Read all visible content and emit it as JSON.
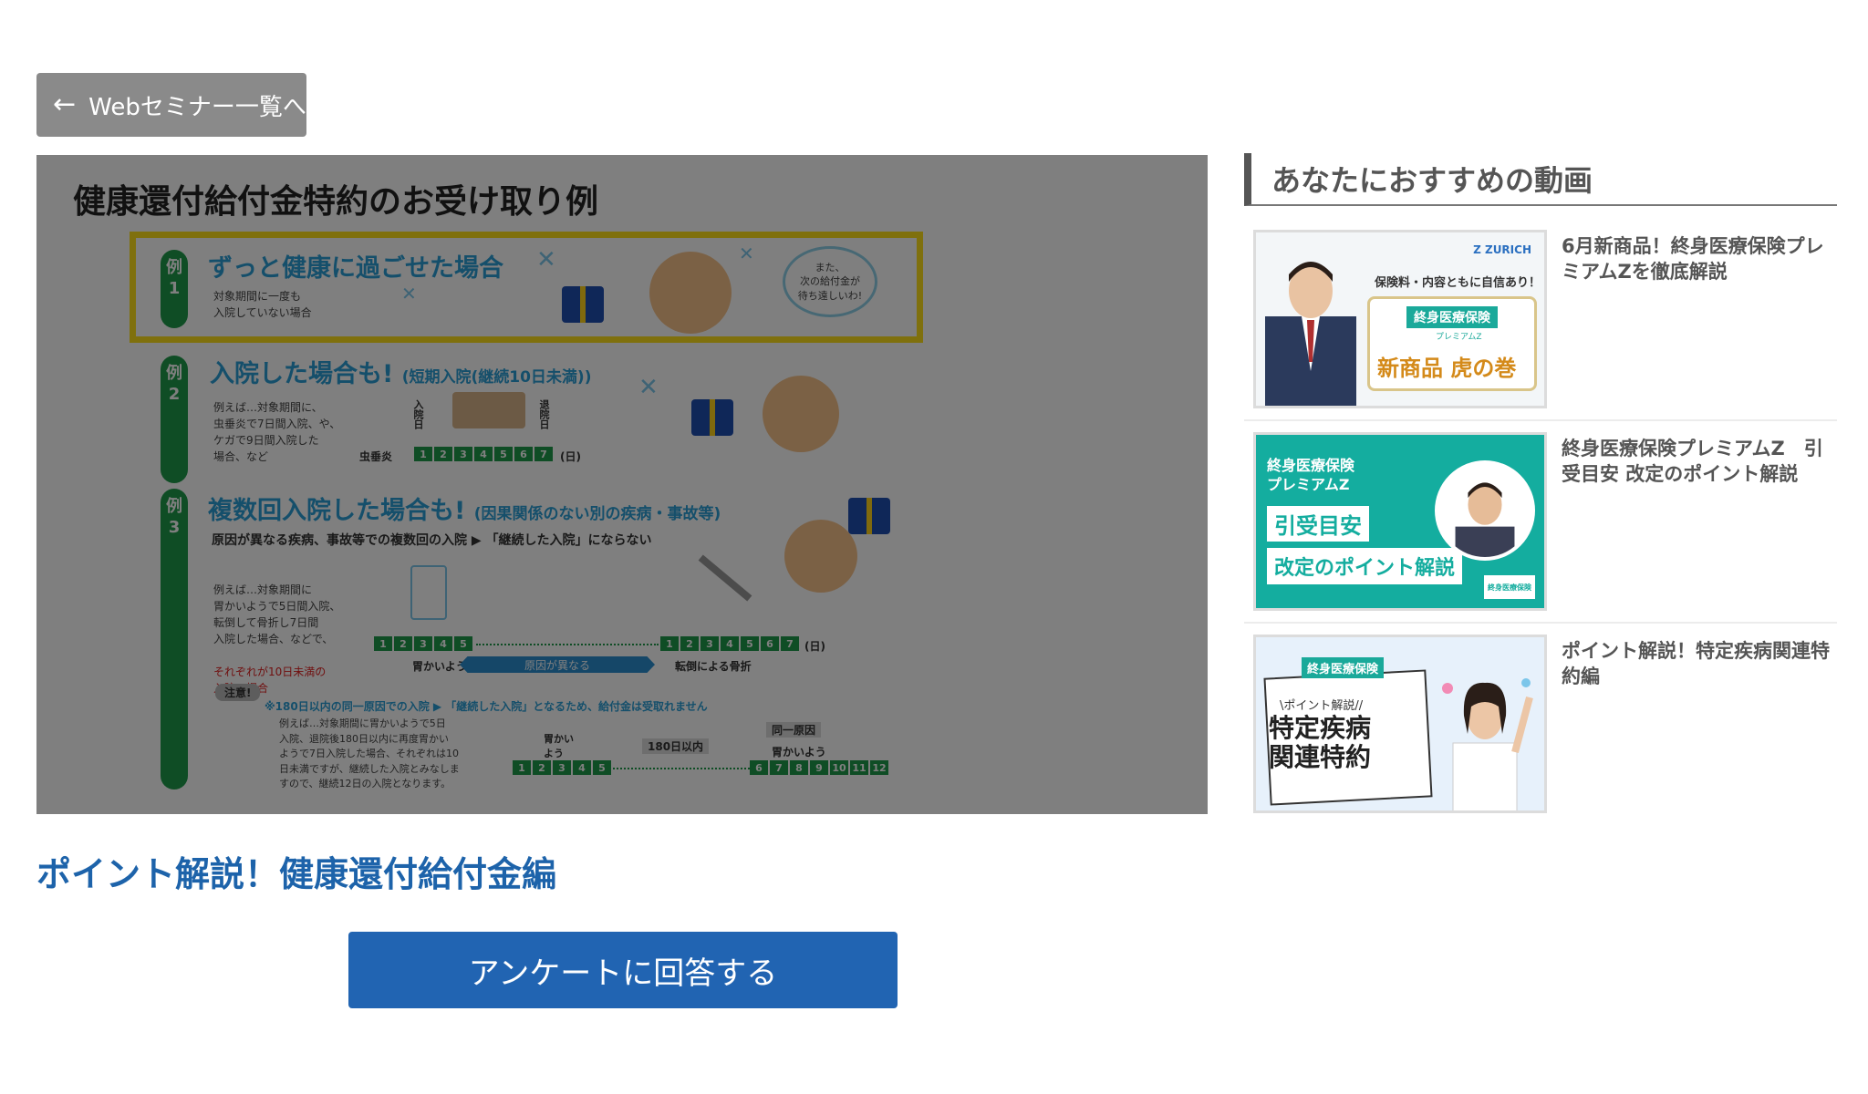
{
  "back_button": {
    "label": "Webセミナー一覧へ"
  },
  "slide": {
    "title": "健康還付給付金特約のお受け取り例",
    "case_badge_prefix": "例",
    "case1": {
      "num": "1",
      "heading": "ずっと健康に過ごせた場合",
      "note": "対象期間に一度も\n入院していない場合",
      "bubble": "また、\n次の給付金が\n待ち遠しいわ!"
    },
    "case2": {
      "num": "2",
      "heading": "入院した場合も!",
      "heading_sub": "(短期入院(継続10日未満))",
      "note": "例えば…対象期間に、\n虫垂炎で7日間入院、や、\nケガで9日間入院した\n場合、など",
      "disease": "虫垂炎",
      "days": [
        "1",
        "2",
        "3",
        "4",
        "5",
        "6",
        "7"
      ],
      "day_unit": "(日)",
      "admit": "入院日",
      "discharge": "退院日"
    },
    "case3": {
      "num": "3",
      "heading": "複数回入院した場合も!",
      "heading_sub": "(因果関係のない別の疾病・事故等)",
      "lead": "原因が異なる疾病、事故等での複数回の入院 ▶ 「継続した入院」にならない",
      "note": "例えば…対象期間に\n胃かいようで5日間入院、\n転倒して骨折し7日間\n入院した場合、などで、",
      "note_red": "それぞれが10日未満の\n入院の場合",
      "left_label": "胃かいよう",
      "middle_label": "原因が異なる",
      "right_label": "転倒による骨折",
      "left_days": [
        "1",
        "2",
        "3",
        "4",
        "5"
      ],
      "right_days": [
        "1",
        "2",
        "3",
        "4",
        "5",
        "6",
        "7"
      ],
      "day_unit": "(日)",
      "attention": "注意!",
      "attention_text": "※180日以内の同一原因での入院 ▶ 「継続した入院」となるため、給付金は受取れません",
      "attention_note": "例えば…対象期間に胃かいようで5日\n入院、退院後180日以内に再度胃かい\nようで7日入院した場合、それぞれは10\n日未満ですが、継続した入院とみなしま\nすので、継続12日の入院となります。",
      "a_left_label": "胃かい\nよう",
      "a_mid_label": "180日以内",
      "a_right_label": "同一原因",
      "a_right_label2": "胃かいよう",
      "a_left_days": [
        "1",
        "2",
        "3",
        "4",
        "5"
      ],
      "a_right_days": [
        "6",
        "7",
        "8",
        "9",
        "10",
        "11",
        "12"
      ]
    }
  },
  "video_title": "ポイント解説！健康還付給付金編",
  "survey_button": {
    "label": "アンケートに回答する"
  },
  "recommend": {
    "heading": "あなたにおすすめの動画",
    "items": [
      {
        "title": "6月新商品！終身医療保険プレミアムZを徹底解説",
        "thumb": {
          "brand": "Z ZURICH",
          "tagline": "保険料・内容ともに自信あり！",
          "label": "終身医療保険",
          "label2": "プレミアムZ",
          "big": "新商品 虎の巻"
        }
      },
      {
        "title": "終身医療保険プレミアムZ　引受目安 改定のポイント解説",
        "thumb": {
          "head": "終身医療保険\nプレミアムZ",
          "box1": "引受目安",
          "box2": "改定のポイント解説",
          "badge": "終身医療保険"
        }
      },
      {
        "title": "ポイント解説！特定疾病関連特約編",
        "thumb": {
          "label": "終身医療保険",
          "sub": "\\ポイント解説//",
          "big": "特定疾病\n関連特約"
        }
      }
    ]
  },
  "colors": {
    "title_blue": "#1d63aa",
    "button_blue": "#2164b2",
    "back_gray": "#8a8a8a",
    "case_green": "#1f9a4a",
    "highlight_yellow": "#ffe01a",
    "teal": "#14ad9f"
  }
}
